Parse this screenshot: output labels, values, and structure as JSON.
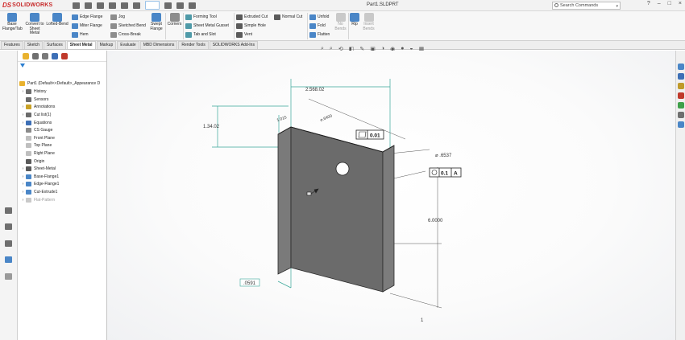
{
  "app": {
    "logo_text": "SOLIDWORKS",
    "document_title": "Part1.SLDPRT",
    "search_placeholder": "Search Commands",
    "window_controls": [
      "?",
      "–",
      "□",
      "×"
    ]
  },
  "ribbon": {
    "large_buttons": [
      {
        "label": "Base Flange/Tab",
        "icon": "base-flange-icon"
      },
      {
        "label": "Convert to Sheet Metal",
        "icon": "convert-sheet-metal-icon"
      },
      {
        "label": "Lofted-Bend",
        "icon": "lofted-bend-icon"
      },
      {
        "label": "Swept Flange",
        "icon": "swept-flange-icon"
      },
      {
        "label": "Corners",
        "icon": "corners-icon"
      }
    ],
    "small_buttons": [
      {
        "label": "Edge Flange",
        "icon": "edge-flange-icon"
      },
      {
        "label": "Miter Flange",
        "icon": "miter-flange-icon"
      },
      {
        "label": "Hem",
        "icon": "hem-icon"
      },
      {
        "label": "Jog",
        "icon": "jog-icon"
      },
      {
        "label": "Sketched Bend",
        "icon": "sketched-bend-icon"
      },
      {
        "label": "Cross-Break",
        "icon": "cross-break-icon"
      },
      {
        "label": "Forming Tool",
        "icon": "forming-tool-icon"
      },
      {
        "label": "Sheet Metal Gusset",
        "icon": "sheet-metal-gusset-icon"
      },
      {
        "label": "Tab and Slot",
        "icon": "tab-and-slot-icon"
      },
      {
        "label": "Extruded Cut",
        "icon": "extruded-cut-icon"
      },
      {
        "label": "Simple Hole",
        "icon": "simple-hole-icon"
      },
      {
        "label": "Vent",
        "icon": "vent-icon"
      },
      {
        "label": "Normal Cut",
        "icon": "normal-cut-icon"
      },
      {
        "label": "Unfold",
        "icon": "unfold-icon"
      },
      {
        "label": "Fold",
        "icon": "fold-icon"
      },
      {
        "label": "Flatten",
        "icon": "flatten-icon"
      }
    ],
    "disabled_buttons": [
      {
        "label": "No Bends",
        "icon": "no-bends-icon"
      },
      {
        "label": "Rip",
        "icon": "rip-icon"
      },
      {
        "label": "Insert Bends",
        "icon": "insert-bends-icon"
      }
    ]
  },
  "tabs": [
    "Features",
    "Sketch",
    "Surfaces",
    "Sheet Metal",
    "Markup",
    "Evaluate",
    "MBD Dimensions",
    "Render Tools",
    "SOLIDWORKS Add-Ins"
  ],
  "active_tab": "Sheet Metal",
  "tree": {
    "root": "Part1  (Default<<Default>_Appearance D",
    "items": [
      {
        "label": "History",
        "icon": "history-icon",
        "expandable": true,
        "dim": false
      },
      {
        "label": "Sensors",
        "icon": "sensors-icon",
        "expandable": false,
        "dim": false
      },
      {
        "label": "Annotations",
        "icon": "annotations-icon",
        "expandable": true,
        "dim": false
      },
      {
        "label": "Cut list(1)",
        "icon": "cut-list-icon",
        "expandable": true,
        "dim": false
      },
      {
        "label": "Equations",
        "icon": "equations-icon",
        "expandable": true,
        "dim": false
      },
      {
        "label": "CS Gauge",
        "icon": "material-icon",
        "expandable": false,
        "dim": false
      },
      {
        "label": "Front Plane",
        "icon": "plane-icon",
        "expandable": false,
        "dim": false
      },
      {
        "label": "Top Plane",
        "icon": "plane-icon",
        "expandable": false,
        "dim": false
      },
      {
        "label": "Right Plane",
        "icon": "plane-icon",
        "expandable": false,
        "dim": false
      },
      {
        "label": "Origin",
        "icon": "origin-icon",
        "expandable": false,
        "dim": false
      },
      {
        "label": "Sheet-Metal",
        "icon": "sheet-metal-icon",
        "expandable": true,
        "dim": false
      },
      {
        "label": "Base-Flange1",
        "icon": "base-flange-icon",
        "expandable": true,
        "dim": false
      },
      {
        "label": "Edge-Flange1",
        "icon": "edge-flange-icon",
        "expandable": true,
        "dim": false
      },
      {
        "label": "Cut-Extrude1",
        "icon": "cut-extrude-icon",
        "expandable": true,
        "dim": false
      },
      {
        "label": "Flat-Pattern",
        "icon": "flat-pattern-icon",
        "expandable": true,
        "dim": true
      }
    ]
  },
  "model": {
    "dims": {
      "width": "2.568.02",
      "height": "1.34.02",
      "depth": "1.015",
      "ref_diameter": "⌀.6400",
      "hole_diameter": "⌀ .6537",
      "length": "6.0000",
      "thickness": ".0591",
      "chain_tag": "1"
    },
    "gdt": {
      "flatness_tol": "0.01",
      "position_tol": "0.1",
      "datum": "A"
    }
  },
  "colors": {
    "accent": "#4a86c7",
    "part_fill": "#6b6b6b",
    "dimension_line": "#3aa79a"
  }
}
